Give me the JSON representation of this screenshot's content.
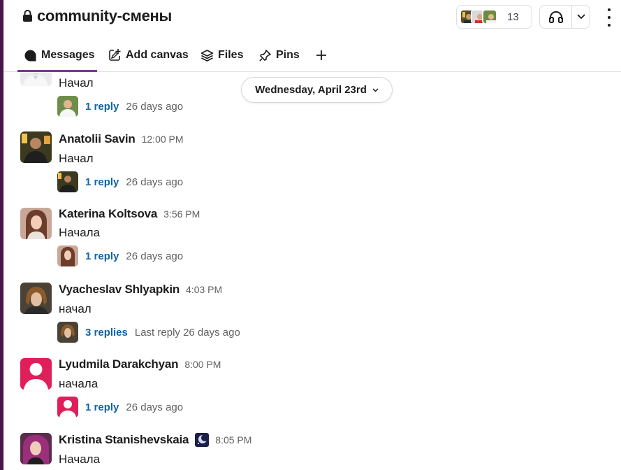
{
  "channel": {
    "name": "community-смены",
    "member_count": "13"
  },
  "tabs": [
    {
      "label": "Messages",
      "icon": "message-icon"
    },
    {
      "label": "Add canvas",
      "icon": "add-canvas-icon"
    },
    {
      "label": "Files",
      "icon": "files-icon"
    },
    {
      "label": "Pins",
      "icon": "pin-icon"
    }
  ],
  "date_divider": "Wednesday, April 23rd",
  "messages": [
    {
      "text": "Начал",
      "thread": {
        "replies": "1 reply",
        "ago": "26 days ago"
      }
    },
    {
      "author": "Anatolii Savin",
      "time": "12:00 PM",
      "text": "Начал",
      "thread": {
        "replies": "1 reply",
        "ago": "26 days ago"
      }
    },
    {
      "author": "Katerina Koltsova",
      "time": "3:56 PM",
      "text": "Начала",
      "thread": {
        "replies": "1 reply",
        "ago": "26 days ago"
      }
    },
    {
      "author": "Vyacheslav Shlyapkin",
      "time": "4:03 PM",
      "text": "начал",
      "thread": {
        "replies": "3 replies",
        "ago": "Last reply 26 days ago"
      }
    },
    {
      "author": "Lyudmila Darakchyan",
      "time": "8:00 PM",
      "text": "начала",
      "thread": {
        "replies": "1 reply",
        "ago": "26 days ago"
      }
    },
    {
      "author": "Kristina Stanishevskaia",
      "time": "8:05 PM",
      "text": "Начала"
    }
  ],
  "colors": {
    "link": "#1264a3",
    "accent": "#7b3a8f",
    "sidebar": "#4a154b",
    "default_avatar": "#e01e5a"
  }
}
